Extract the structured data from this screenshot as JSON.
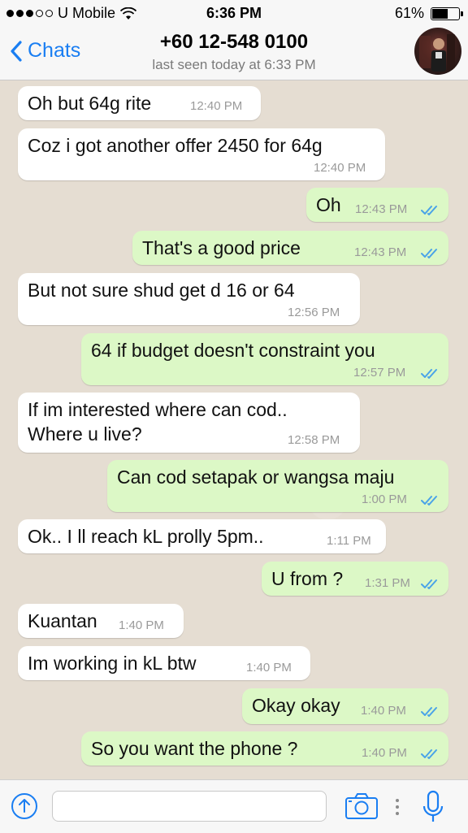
{
  "status_bar": {
    "carrier": "U Mobile",
    "time": "6:36 PM",
    "battery": "61%",
    "battery_level": 0.61
  },
  "header": {
    "back_label": "Chats",
    "contact_name": "+60 12-548 0100",
    "last_seen": "last seen today at 6:33 PM"
  },
  "messages": [
    {
      "dir": "in",
      "text": "Oh but 64g rite",
      "time": "12:40 PM"
    },
    {
      "dir": "in",
      "text": "Coz i got another offer 2450 for 64g",
      "time": "12:40 PM"
    },
    {
      "dir": "out",
      "text": "Oh",
      "time": "12:43 PM"
    },
    {
      "dir": "out",
      "text": "That's a good price",
      "time": "12:43 PM"
    },
    {
      "dir": "in",
      "text": "But not sure shud get d 16 or 64",
      "time": "12:56 PM"
    },
    {
      "dir": "out",
      "text": "64 if budget doesn't constraint you",
      "time": "12:57 PM"
    },
    {
      "dir": "in",
      "text": "If im interested where can cod..",
      "text2": "Where u live?",
      "time": "12:58 PM"
    },
    {
      "dir": "out",
      "text": "Can cod setapak or wangsa maju",
      "time": "1:00 PM"
    },
    {
      "dir": "in",
      "text": "Ok.. I ll reach kL prolly 5pm..",
      "time": "1:11 PM"
    },
    {
      "dir": "out",
      "text": "U from ?",
      "time": "1:31 PM"
    },
    {
      "dir": "in",
      "text": "Kuantan",
      "time": "1:40 PM"
    },
    {
      "dir": "in",
      "text": "Im working in kL btw",
      "time": "1:40 PM"
    },
    {
      "dir": "out",
      "text": "Okay okay",
      "time": "1:40 PM"
    },
    {
      "dir": "out",
      "text": "So you want the phone ?",
      "time": "1:40 PM"
    }
  ],
  "input": {
    "placeholder": ""
  },
  "icons": {
    "accent": "#1a7ef2",
    "tick_color": "#4aa3e8",
    "incoming_bubble": "#ffffff",
    "outgoing_bubble": "#dcf8c6"
  }
}
